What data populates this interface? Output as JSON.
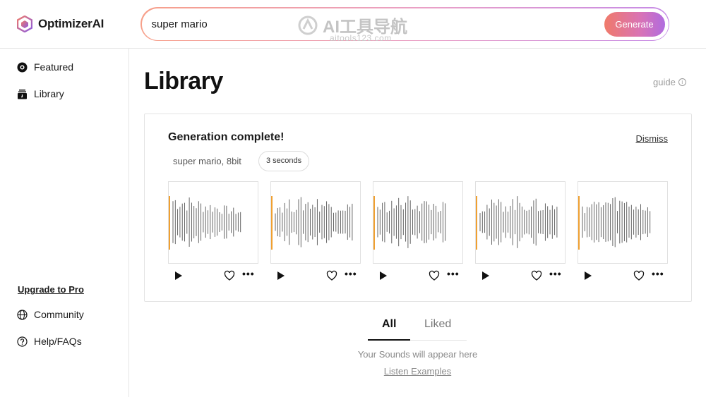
{
  "app": {
    "name": "OptimizerAI"
  },
  "header": {
    "search_value": "super mario",
    "generate_label": "Generate",
    "watermark_title": "AI工具导航",
    "watermark_sub": "aitools123.com"
  },
  "sidebar": {
    "items": [
      {
        "label": "Featured",
        "icon": "featured-icon"
      },
      {
        "label": "Library",
        "icon": "library-icon"
      }
    ],
    "upgrade_label": "Upgrade to Pro",
    "bottom_items": [
      {
        "label": "Community",
        "icon": "globe-icon"
      },
      {
        "label": "Help/FAQs",
        "icon": "help-icon"
      }
    ]
  },
  "main": {
    "title": "Library",
    "guide_label": "guide",
    "generation": {
      "title": "Generation complete!",
      "dismiss_label": "Dismiss",
      "prompt": "super mario, 8bit",
      "duration": "3 seconds",
      "accent_color": "#f0a030",
      "waveform_color": "#555555"
    },
    "tabs": [
      {
        "label": "All",
        "active": true
      },
      {
        "label": "Liked",
        "active": false
      }
    ],
    "empty_text": "Your Sounds will appear here",
    "examples_label": "Listen Examples"
  }
}
